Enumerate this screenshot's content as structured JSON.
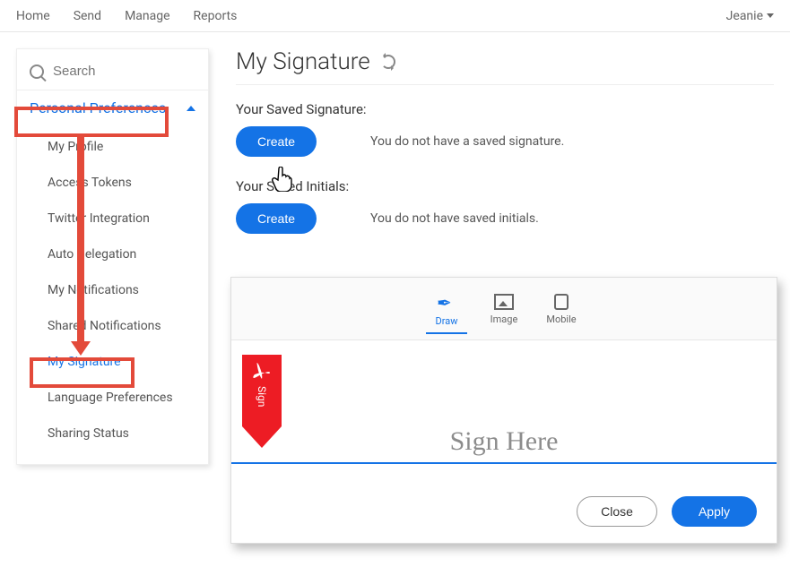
{
  "topnav": {
    "items": [
      "Home",
      "Send",
      "Manage",
      "Reports"
    ],
    "user": "Jeanie"
  },
  "sidebar": {
    "search_placeholder": "Search",
    "section_title": "Personal Preferences",
    "items": [
      {
        "label": "My Profile"
      },
      {
        "label": "Access Tokens"
      },
      {
        "label": "Twitter Integration"
      },
      {
        "label": "Auto Delegation"
      },
      {
        "label": "My Notifications"
      },
      {
        "label": "Shared Notifications"
      },
      {
        "label": "My Signature"
      },
      {
        "label": "Language Preferences"
      },
      {
        "label": "Sharing Status"
      }
    ]
  },
  "main": {
    "title": "My Signature",
    "signature_heading": "Your Saved Signature:",
    "signature_button": "Create",
    "signature_empty": "You do not have a saved signature.",
    "initials_heading": "Your Saved Initials:",
    "initials_button": "Create",
    "initials_empty": "You do not have saved initials."
  },
  "modal": {
    "tabs": {
      "draw": "Draw",
      "image": "Image",
      "mobile": "Mobile"
    },
    "adobe_sign_label": "Sign",
    "placeholder_text": "Sign Here",
    "close": "Close",
    "apply": "Apply"
  },
  "colors": {
    "accent": "#1473e6",
    "annotation": "#e34a3a",
    "adobe_red": "#ed1c24"
  }
}
